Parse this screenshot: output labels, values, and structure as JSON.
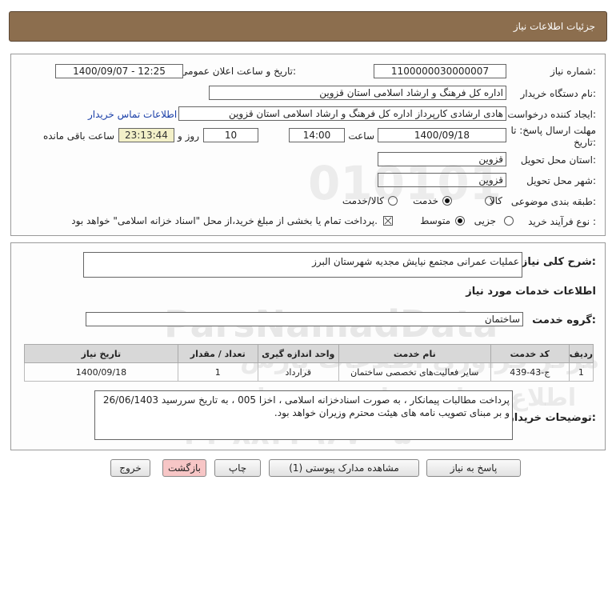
{
  "header": {
    "title": "جزئیات اطلاعات نیاز"
  },
  "form": {
    "need_number_label": "شماره نیاز:",
    "need_number": "1100000030000007",
    "announce_label": "تاریخ و ساعت اعلان عمومی:",
    "announce_value": "1400/09/07 - 12:25",
    "buyer_org_label": "نام دستگاه خریدار:",
    "buyer_org": "اداره کل فرهنگ و ارشاد اسلامی استان قزوین",
    "requester_label": "ایجاد کننده درخواست:",
    "requester": "هادی ارشادی کارپرداز اداره کل فرهنگ و ارشاد اسلامی استان قزوین",
    "contact_link": "اطلاعات تماس خریدار",
    "deadline_label_1": "مهلت ارسال پاسخ: تا",
    "deadline_label_2": "تاریخ:",
    "deadline_date": "1400/09/18",
    "time_label": "ساعت",
    "deadline_time": "14:00",
    "days_value": "10",
    "days_label": "روز و",
    "remaining_time": "23:13:44",
    "remaining_label": "ساعت باقی مانده",
    "province_label": "استان محل تحویل:",
    "province": "قزوین",
    "city_label": "شهر محل تحویل:",
    "city": "قزوین",
    "category_label": "طبقه بندی موضوعی:",
    "category_options": [
      "کالا",
      "خدمت",
      "کالا/خدمت"
    ],
    "category_selected": "خدمت",
    "process_label": "نوع فرآیند خرید :",
    "process_options": [
      "جزیی",
      "متوسط"
    ],
    "process_selected": "متوسط",
    "treasury_note": "پرداخت تمام یا بخشی از مبلغ خرید،از محل \"اسناد خزانه اسلامی\" خواهد بود."
  },
  "description": {
    "label": "شرح کلی نیاز:",
    "value": "عملیات عمرانی مجتمع نیایش مجدیه شهرستان البرز"
  },
  "services": {
    "section_title": "اطلاعات خدمات مورد نیاز",
    "group_label": "گروه خدمت:",
    "group_value": "ساختمان",
    "table": {
      "headers": [
        "ردیف",
        "کد خدمت",
        "نام خدمت",
        "واحد اندازه گیری",
        "تعداد / مقدار",
        "تاریخ نیاز"
      ],
      "rows": [
        [
          "1",
          "ج-43-439",
          "سایر فعالیت‌های تخصصی ساختمان",
          "قرارداد",
          "1",
          "1400/09/18"
        ]
      ]
    }
  },
  "buyer_notes": {
    "label": "توضیحات خریدار:",
    "value": "پرداخت مطالبات پیمانکار ، به صورت اسنادخزانه اسلامی ، اخزا 005 ، به تاریخ سررسید 26/06/1403 و بر مبنای تصویب نامه های هیئت محترم وزیران  خواهد بود."
  },
  "buttons": {
    "reply": "پاسخ به نیاز",
    "attachments": "مشاهده مدارک پیوستی (1)",
    "print": "چاپ",
    "back": "بازگشت",
    "exit": "خروج"
  },
  "watermark": {
    "brand": "ParsNamadData",
    "line1": "مرکز فراوری اطلاعات پارس",
    "line2": "اطلاع رسانی مناقصه و مزایده",
    "phone": "۰۲۱-۸۸۳۴۹۶۷۰-۵",
    "digits": "010101"
  },
  "colors": {
    "header_bg": "#8c6e4e",
    "remaining_bg": "#f3f0c8",
    "back_button_bg": "#f7c6c6",
    "link": "#1a3fa8"
  }
}
